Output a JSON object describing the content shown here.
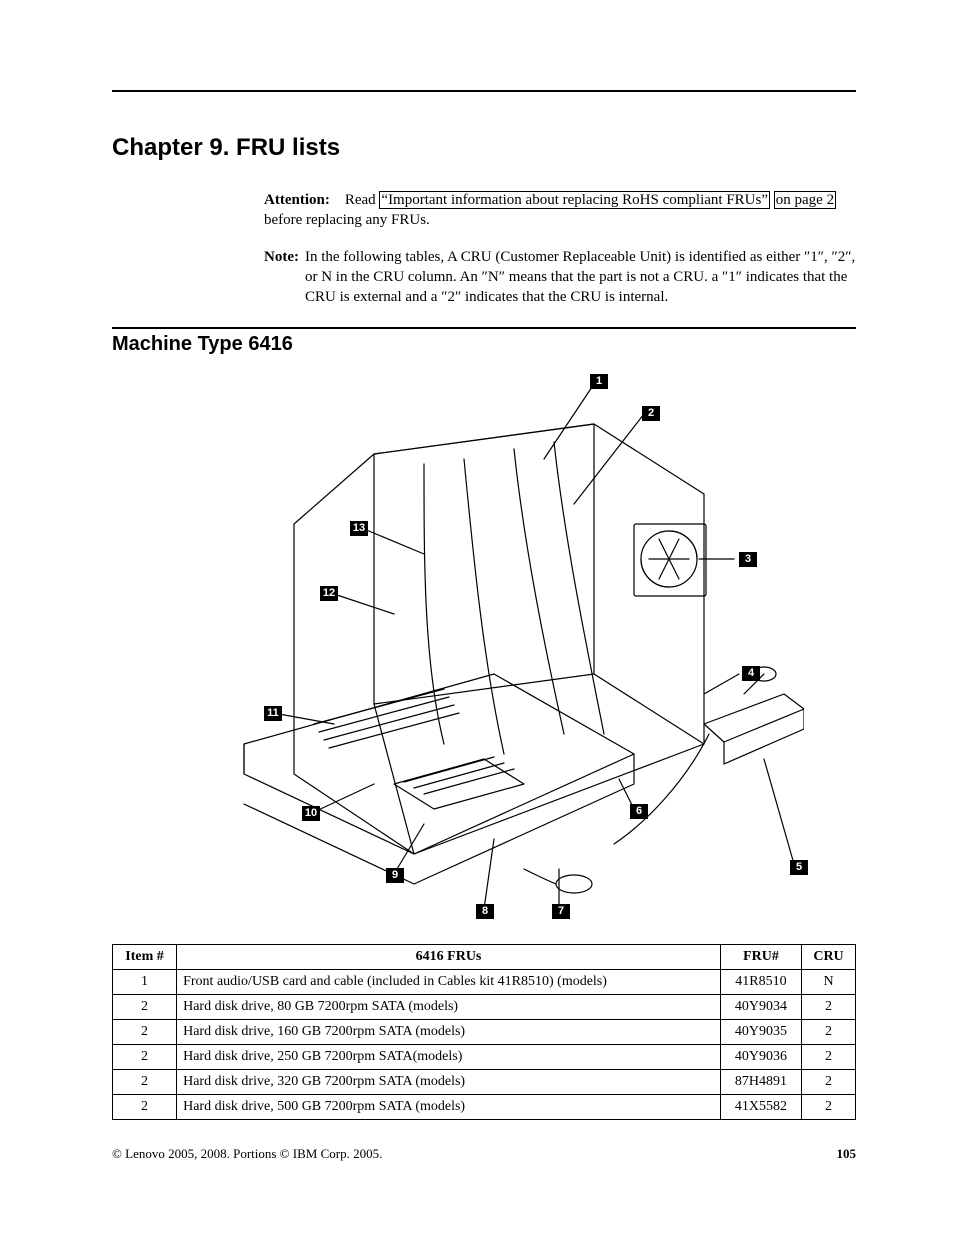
{
  "chapter_title": "Chapter 9. FRU lists",
  "attention": {
    "label": "Attention:",
    "pre_link": "Read ",
    "link1": "“Important information about replacing RoHS compliant FRUs”",
    "link2": "on page 2",
    "post_link": " before replacing any FRUs."
  },
  "note": {
    "label": "Note:",
    "text": "In the following tables, A CRU (Customer Replaceable Unit) is identified as either ″1″, ″2″, or N in the CRU column. An ″N″ means that the part is not a CRU. a ″1″ indicates that the CRU is external and a ″2″ indicates that the CRU is internal."
  },
  "machine_title": "Machine Type 6416",
  "callouts": {
    "c1": "1",
    "c2": "2",
    "c3": "3",
    "c4": "4",
    "c5": "5",
    "c6": "6",
    "c7": "7",
    "c8": "8",
    "c9": "9",
    "c10": "10",
    "c11": "11",
    "c12": "12",
    "c13": "13"
  },
  "table": {
    "headers": {
      "item": "Item #",
      "desc": "6416 FRUs",
      "fru": "FRU#",
      "cru": "CRU"
    },
    "rows": [
      {
        "item": "1",
        "desc": "Front audio/USB card and cable (included in Cables kit 41R8510) (models)",
        "fru": "41R8510",
        "cru": "N"
      },
      {
        "item": "2",
        "desc": "Hard disk drive, 80 GB 7200rpm SATA (models)",
        "fru": "40Y9034",
        "cru": "2"
      },
      {
        "item": "2",
        "desc": "Hard disk drive, 160 GB 7200rpm SATA (models)",
        "fru": "40Y9035",
        "cru": "2"
      },
      {
        "item": "2",
        "desc": "Hard disk drive, 250 GB 7200rpm SATA(models)",
        "fru": "40Y9036",
        "cru": "2"
      },
      {
        "item": "2",
        "desc": "Hard disk drive, 320 GB 7200rpm SATA (models)",
        "fru": "87H4891",
        "cru": "2"
      },
      {
        "item": "2",
        "desc": "Hard disk drive, 500 GB 7200rpm SATA (models)",
        "fru": "41X5582",
        "cru": "2"
      }
    ]
  },
  "footer": {
    "copyright": "© Lenovo 2005, 2008. Portions © IBM Corp. 2005.",
    "pagenum": "105"
  }
}
